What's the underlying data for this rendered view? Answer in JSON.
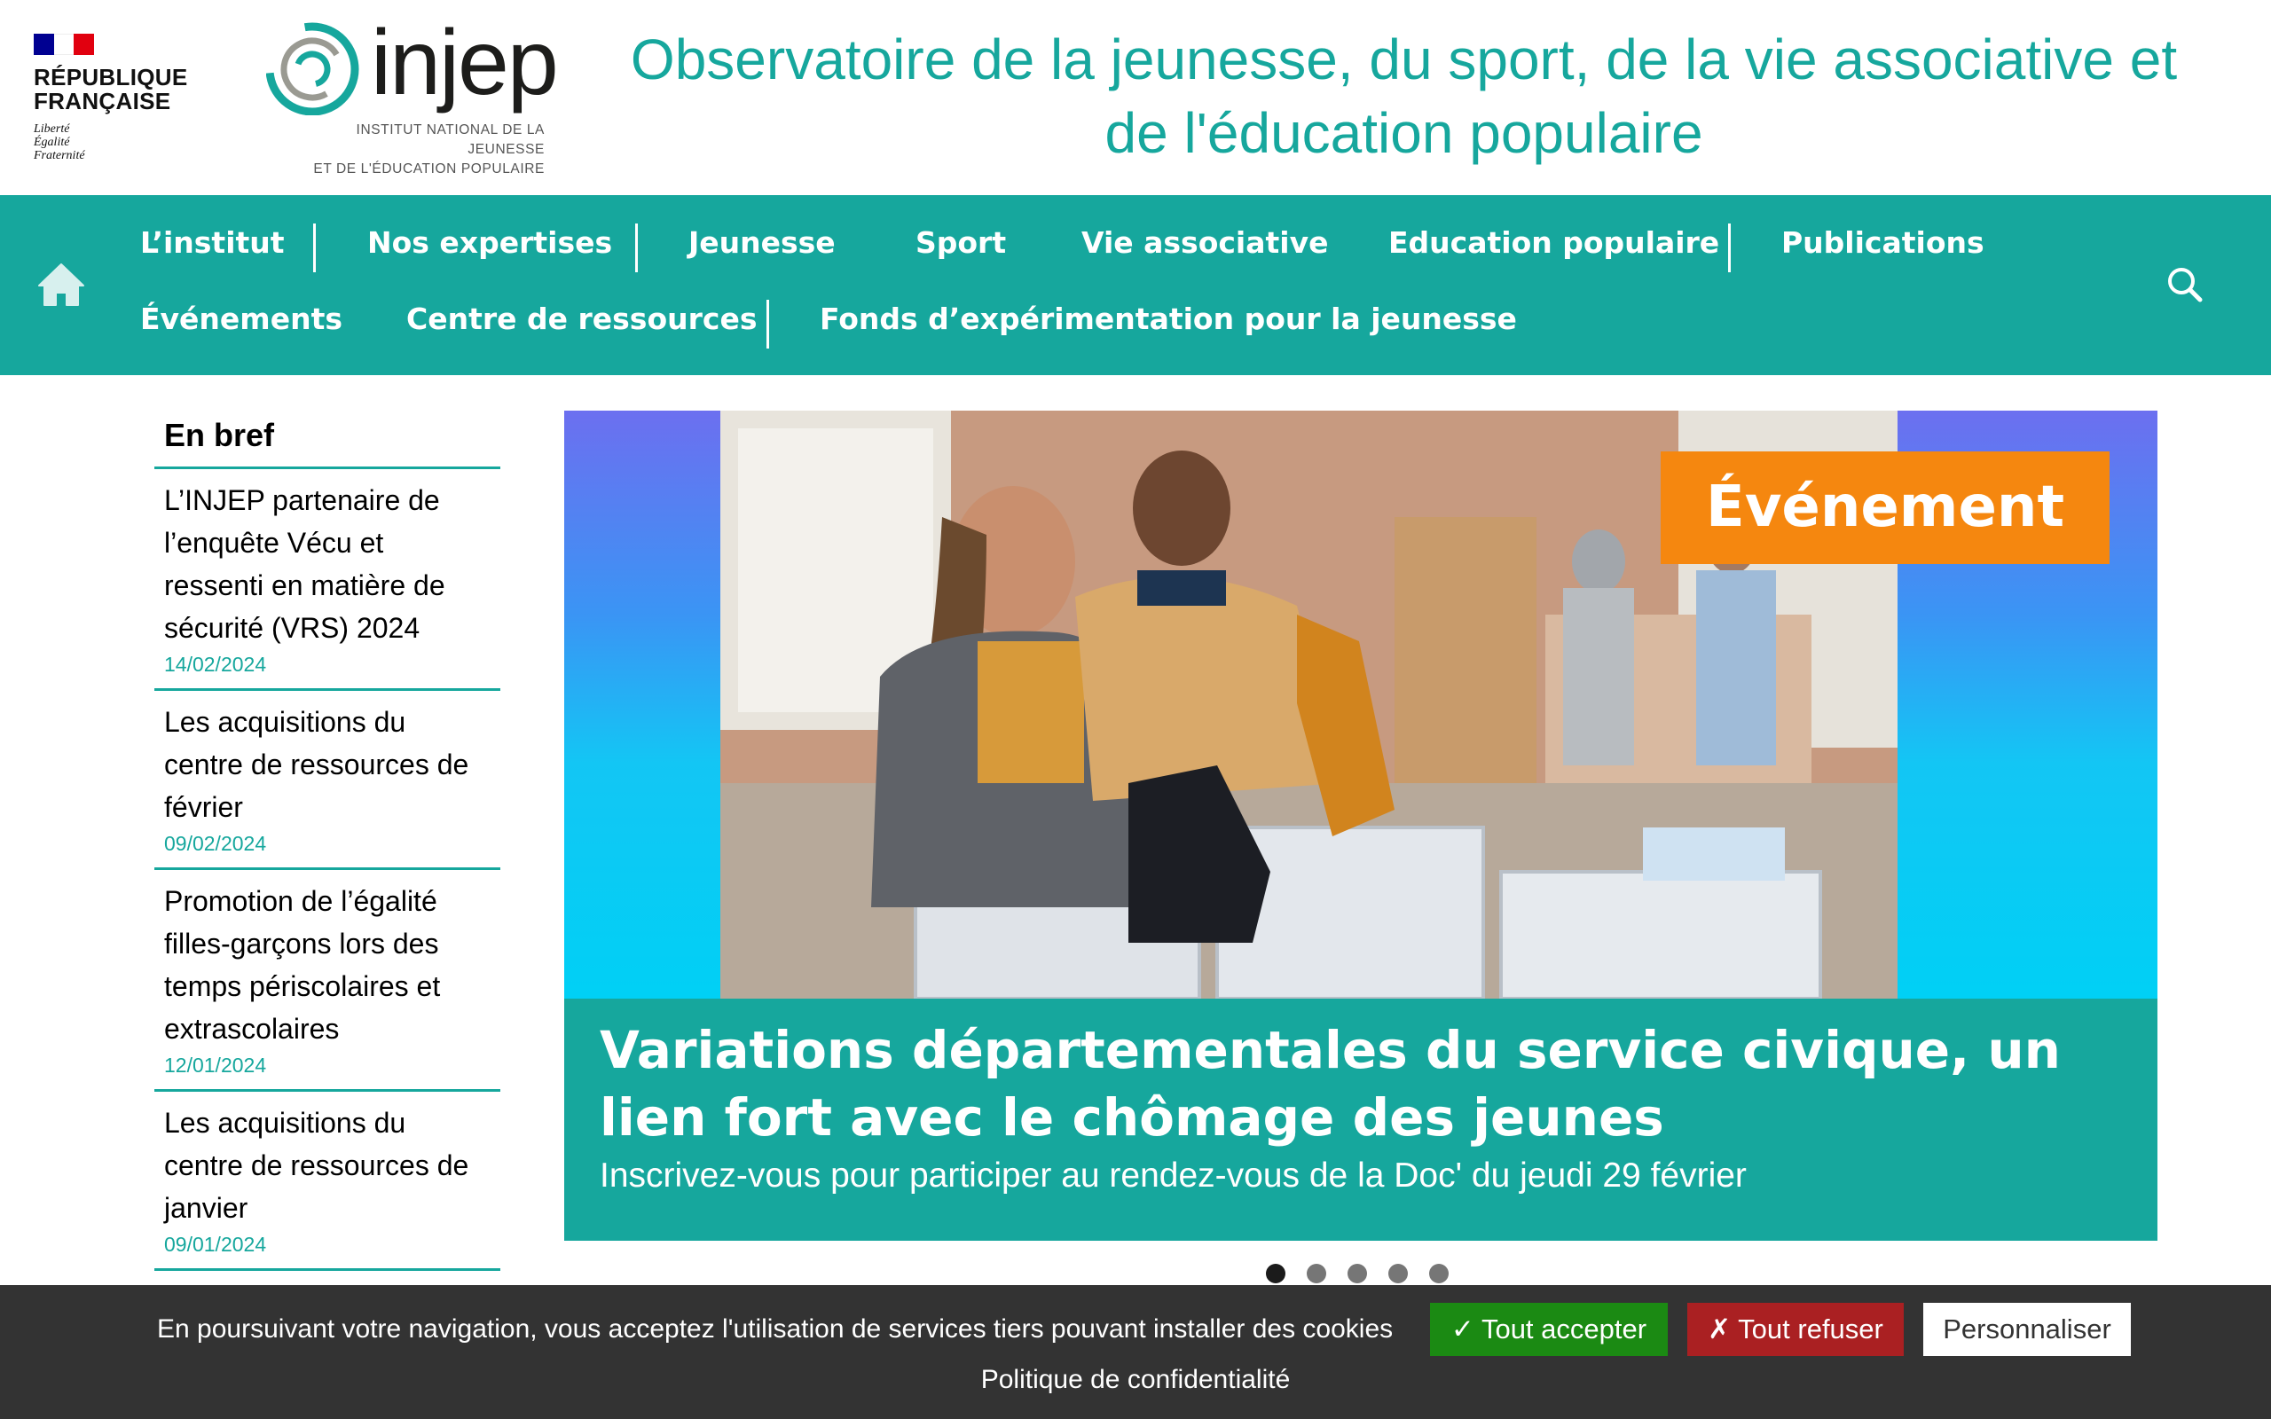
{
  "header": {
    "republique": {
      "title_line1": "RÉPUBLIQUE",
      "title_line2": "FRANÇAISE",
      "motto_line1": "Liberté",
      "motto_line2": "Égalité",
      "motto_line3": "Fraternité",
      "flag_colors": [
        "#000091",
        "#ffffff",
        "#e1000f"
      ]
    },
    "injep": {
      "wordmark": "injep",
      "subtitle_line1": "INSTITUT NATIONAL DE LA JEUNESSE",
      "subtitle_line2": "ET DE L'ÉDUCATION POPULAIRE"
    },
    "site_title": "Observatoire de la jeunesse, du sport, de la vie associative et de l'éducation populaire"
  },
  "nav": {
    "home_icon": "home-icon",
    "search_icon": "search-icon",
    "items": [
      {
        "label": "L’institut"
      },
      {
        "label": "Nos expertises"
      },
      {
        "label": "Jeunesse"
      },
      {
        "label": "Sport"
      },
      {
        "label": "Vie associative"
      },
      {
        "label": "Education populaire"
      },
      {
        "label": "Publications"
      },
      {
        "label": "Événements"
      },
      {
        "label": "Centre de ressources"
      },
      {
        "label": "Fonds d’expérimentation pour la jeunesse"
      }
    ]
  },
  "bref": {
    "title": "En bref",
    "items": [
      {
        "text": "L’INJEP partenaire de l’enquête Vécu et ressenti en matière de sécurité (VRS) 2024",
        "date": "14/02/2024"
      },
      {
        "text": "Les acquisitions du centre de ressources de février",
        "date": "09/02/2024"
      },
      {
        "text": "Promotion de l’égalité filles-garçons lors des temps périscolaires et extrascolaires",
        "date": "12/01/2024"
      },
      {
        "text": "Les acquisitions du centre de ressources de janvier",
        "date": "09/01/2024"
      }
    ]
  },
  "carousel": {
    "badge": "Événement",
    "title": "Variations départementales du service civique, un lien fort avec le chômage des jeunes",
    "subtitle": "Inscrivez-vous pour participer au rendez-vous de la Doc' du jeudi 29 février",
    "slide_count": 5,
    "active_slide": 1
  },
  "cookie": {
    "message": "En poursuivant votre navigation, vous acceptez l'utilisation de services tiers pouvant installer des cookies",
    "accept": "✓ Tout accepter",
    "refuse": "✗ Tout refuser",
    "customize": "Personnaliser",
    "privacy": "Politique de confidentialité"
  },
  "colors": {
    "brand_teal": "#16a79d",
    "badge_orange": "#f5870f",
    "cookie_bg": "#333333",
    "accept_green": "#1b8a13",
    "refuse_red": "#aa2022"
  }
}
